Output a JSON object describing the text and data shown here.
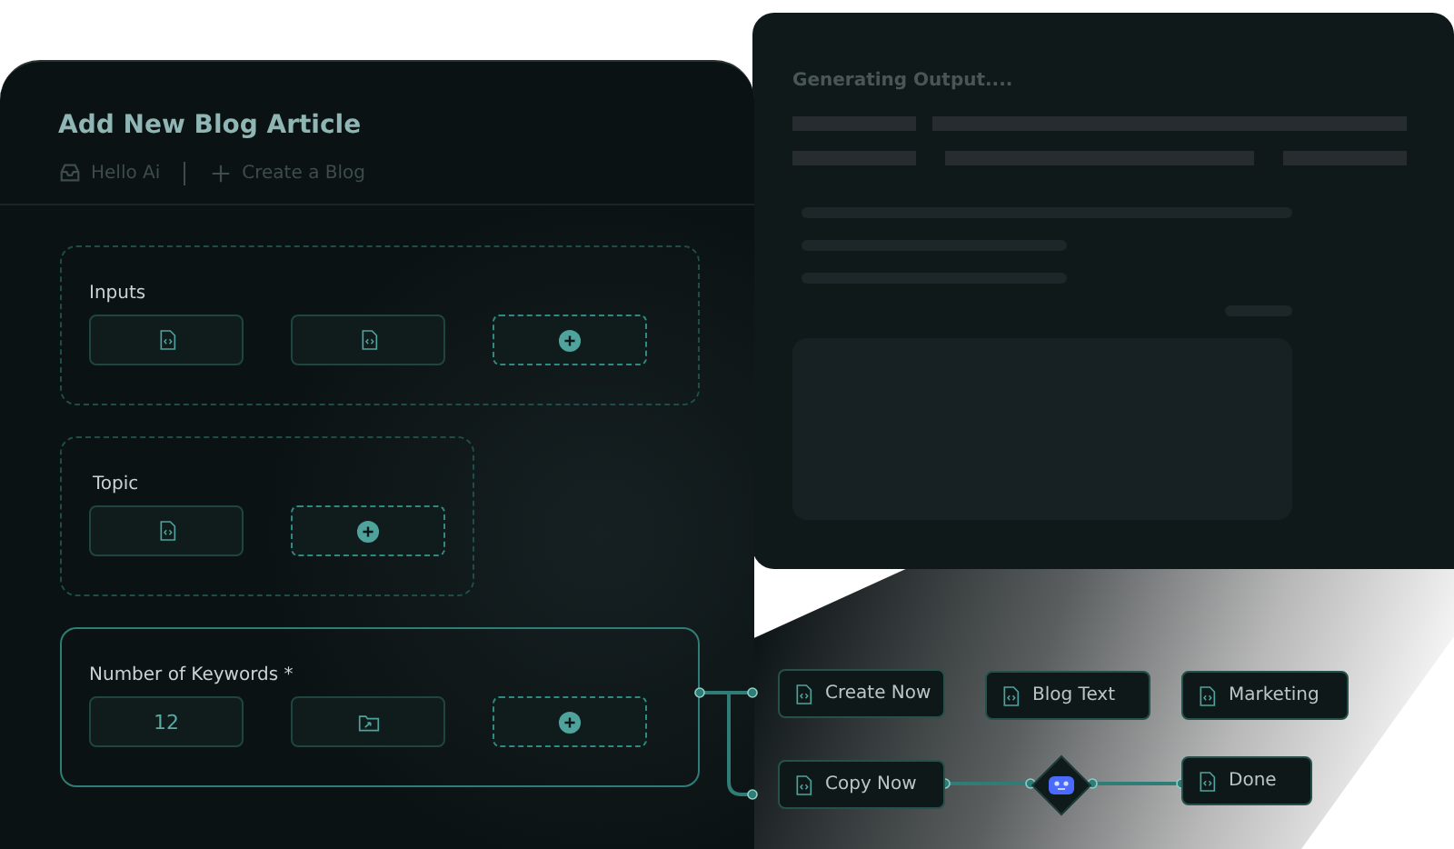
{
  "main_panel": {
    "title": "Add New Blog Article",
    "breadcrumb": [
      {
        "label": "Hello Ai",
        "kind": "inbox"
      },
      {
        "label": "Create a Blog",
        "kind": "plus"
      }
    ],
    "groups": [
      {
        "label": "Inputs",
        "active": false,
        "slots": [
          {
            "kind": "file"
          },
          {
            "kind": "file"
          },
          {
            "kind": "add"
          }
        ]
      },
      {
        "label": "Topic",
        "active": false,
        "slots": [
          {
            "kind": "file"
          },
          {
            "kind": "add"
          }
        ]
      },
      {
        "label": "Number of Keywords *",
        "active": true,
        "slots": [
          {
            "kind": "value",
            "value": "12"
          },
          {
            "kind": "folder"
          },
          {
            "kind": "add"
          }
        ]
      }
    ]
  },
  "output_panel": {
    "title": "Generating Output...."
  },
  "flow_nodes": [
    {
      "kind": "chip",
      "label": "Create Now"
    },
    {
      "kind": "chip",
      "label": "Blog Text"
    },
    {
      "kind": "chip",
      "label": "Marketing"
    },
    {
      "kind": "chip",
      "label": "Copy Now"
    },
    {
      "kind": "robot"
    },
    {
      "kind": "chip",
      "label": "Done"
    }
  ]
}
